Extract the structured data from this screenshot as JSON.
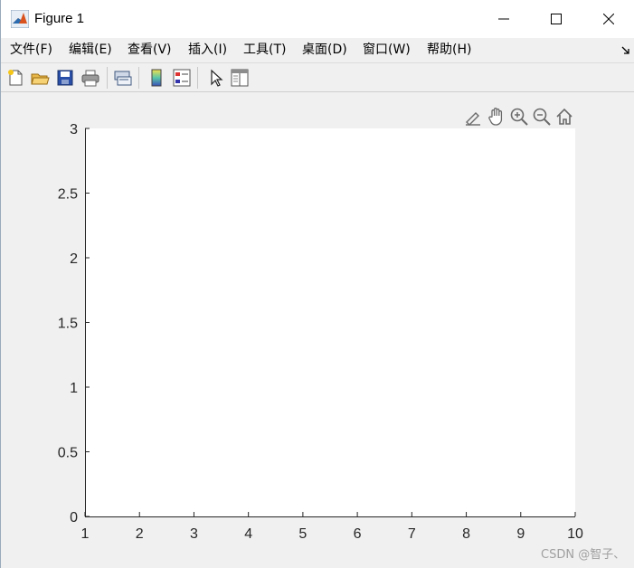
{
  "window": {
    "title": "Figure 1",
    "minimize_icon": "minimize-icon",
    "maximize_icon": "maximize-icon",
    "close_icon": "close-icon"
  },
  "menu": {
    "items": [
      {
        "label": "文件(F)"
      },
      {
        "label": "编辑(E)"
      },
      {
        "label": "查看(V)"
      },
      {
        "label": "插入(I)"
      },
      {
        "label": "工具(T)"
      },
      {
        "label": "桌面(D)"
      },
      {
        "label": "窗口(W)"
      },
      {
        "label": "帮助(H)"
      }
    ]
  },
  "toolbar": {
    "buttons": [
      "new-figure-icon",
      "open-file-icon",
      "save-icon",
      "print-icon",
      "link-plot-icon",
      "colorbar-icon",
      "legend-icon",
      "edit-plot-icon",
      "property-inspector-icon"
    ]
  },
  "axes_toolbar": {
    "tools": [
      "brush-icon",
      "pan-icon",
      "zoom-in-icon",
      "zoom-out-icon",
      "home-icon"
    ]
  },
  "chart_data": {
    "type": "line",
    "title": "",
    "xlabel": "",
    "ylabel": "",
    "xlim": [
      1,
      10
    ],
    "ylim": [
      0,
      3
    ],
    "x_ticks": [
      "1",
      "2",
      "3",
      "4",
      "5",
      "6",
      "7",
      "8",
      "9",
      "10"
    ],
    "y_ticks": [
      "0",
      "0.5",
      "1",
      "1.5",
      "2",
      "2.5",
      "3"
    ],
    "series": [],
    "grid": false,
    "colors": {
      "axis": "#262626",
      "background": "#ffffff",
      "figure": "#f0f0f0"
    }
  },
  "watermark": "CSDN @智子、"
}
